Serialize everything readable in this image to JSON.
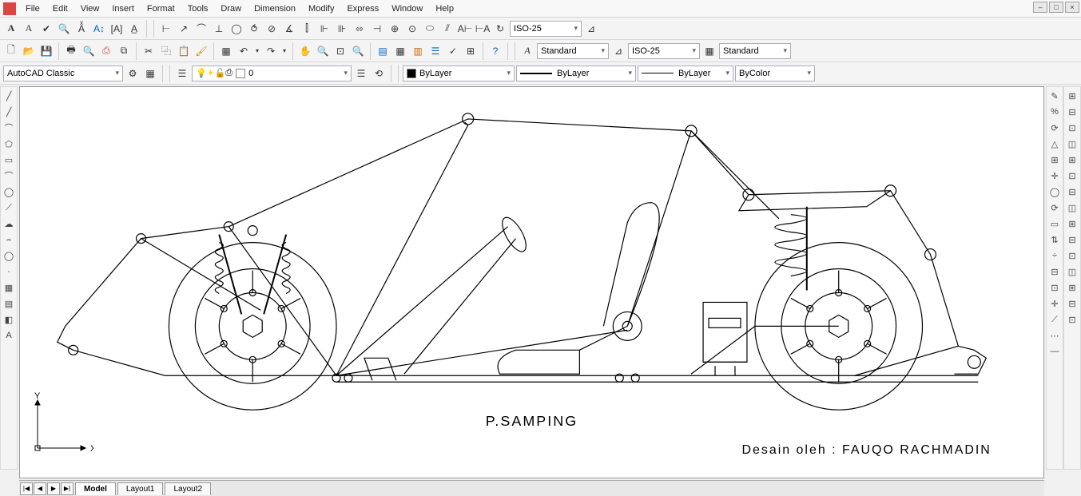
{
  "menus": [
    "File",
    "Edit",
    "View",
    "Insert",
    "Format",
    "Tools",
    "Draw",
    "Dimension",
    "Modify",
    "Express",
    "Window",
    "Help"
  ],
  "row1": {
    "dimstyle_dd": "ISO-25"
  },
  "row2": {
    "textstyle_dd": "Standard",
    "dimstyle_dd": "ISO-25",
    "tablestyle_dd": "Standard"
  },
  "row3": {
    "workspace_dd": "AutoCAD Classic",
    "layer_dd": "0",
    "color_dd": "ByLayer",
    "ltype_dd": "ByLayer",
    "lweight_dd": "ByLayer",
    "plotstyle_dd": "ByColor"
  },
  "tabs": {
    "nav": [
      "|◀",
      "◀",
      "▶",
      "▶|"
    ],
    "items": [
      "Model",
      "Layout1",
      "Layout2"
    ],
    "active": 0
  },
  "drawing": {
    "title": "P.SAMPING",
    "credit": "Desain oleh : FAUQO RACHMADIN",
    "axis_x": "X",
    "axis_y": "Y"
  },
  "icons": {
    "left": [
      "╱",
      "╱",
      "⌒",
      "⬠",
      "▭",
      "⌒",
      "◯",
      "⟋",
      "☁",
      "⌢",
      "◯",
      "·",
      "▦",
      "▤",
      "◧",
      "A"
    ],
    "right1": [
      "✎",
      "%",
      "⟳",
      "△",
      "⊞",
      "✛",
      "◯",
      "⟳",
      "▭",
      "⇅",
      "÷",
      "⊟",
      "⊡",
      "✛",
      "⟋",
      "⋯",
      "—"
    ],
    "right2": [
      "⊞",
      "⊟",
      "⊡",
      "◫",
      "⊞",
      "⊡",
      "⊟",
      "◫",
      "⊞",
      "⊟",
      "⊡",
      "◫",
      "⊞",
      "⊟",
      "⊡"
    ]
  }
}
